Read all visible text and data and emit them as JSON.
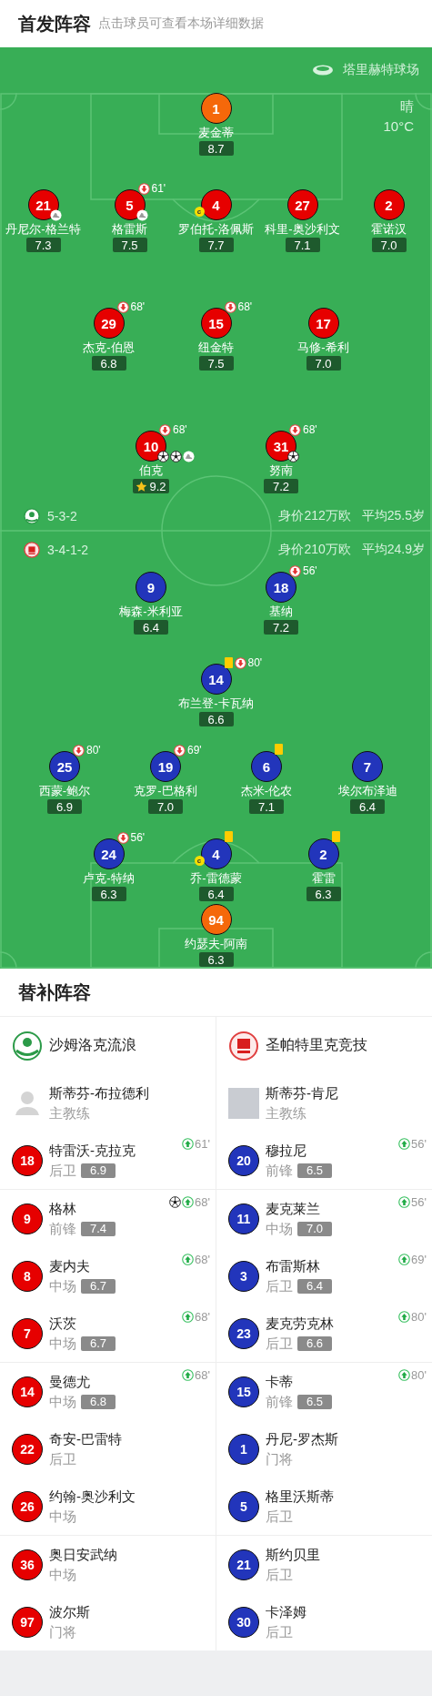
{
  "header": {
    "title": "首发阵容",
    "subtitle": "点击球员可查看本场详细数据"
  },
  "pitch": {
    "venue": "塔里赫特球场",
    "weather": {
      "condition": "晴",
      "temperature": "10°C"
    },
    "home": {
      "formation": "5-3-2",
      "market_value": "身价212万欧",
      "average_age": "平均25.5岁",
      "rows": [
        {
          "players": [
            {
              "number": "1",
              "name": "麦金蒂",
              "rating": "8.7",
              "color": "#f5680a",
              "yellow_card": false,
              "best": false
            }
          ]
        },
        {
          "players": [
            {
              "number": "21",
              "name": "丹尼尔-格兰特",
              "rating": "7.3",
              "color": "#e60000",
              "yellow_card": false,
              "best": false,
              "events": [
                {
                  "kind": "assist"
                }
              ]
            },
            {
              "number": "5",
              "name": "格雷斯",
              "rating": "7.5",
              "color": "#e60000",
              "yellow_card": false,
              "best": false,
              "sub_off": "61'",
              "events": [
                {
                  "kind": "assist"
                }
              ]
            },
            {
              "number": "4",
              "name": "罗伯托-洛佩斯",
              "rating": "7.7",
              "color": "#e60000",
              "captain_badge": "c",
              "yellow_card": false,
              "best": false
            },
            {
              "number": "27",
              "name": "科里-奥沙利文",
              "rating": "7.1",
              "color": "#e60000",
              "yellow_card": false,
              "best": false
            },
            {
              "number": "2",
              "name": "霍诺汉",
              "rating": "7.0",
              "color": "#e60000",
              "yellow_card": false,
              "best": false
            }
          ]
        },
        {
          "players": [
            {
              "number": "29",
              "name": "杰克-伯恩",
              "rating": "6.8",
              "color": "#e60000",
              "yellow_card": false,
              "best": false,
              "sub_off": "68'"
            },
            {
              "number": "15",
              "name": "纽金特",
              "rating": "7.5",
              "color": "#e60000",
              "yellow_card": false,
              "best": false,
              "sub_off": "68'"
            },
            {
              "number": "17",
              "name": "马修-希利",
              "rating": "7.0",
              "color": "#e60000",
              "yellow_card": false,
              "best": false
            }
          ]
        },
        {
          "players": [
            {
              "number": "10",
              "name": "伯克",
              "rating": "9.2",
              "color": "#e60000",
              "yellow_card": false,
              "best": true,
              "sub_off": "68'",
              "events": [
                {
                  "kind": "goal"
                },
                {
                  "kind": "goal"
                },
                {
                  "kind": "assist"
                }
              ]
            },
            {
              "number": "31",
              "name": "努南",
              "rating": "7.2",
              "color": "#e60000",
              "yellow_card": false,
              "best": false,
              "sub_off": "68'",
              "events": [
                {
                  "kind": "goal"
                }
              ]
            }
          ]
        }
      ]
    },
    "away": {
      "formation": "3-4-1-2",
      "market_value": "身价210万欧",
      "average_age": "平均24.9岁",
      "rows": [
        {
          "players": [
            {
              "number": "9",
              "name": "梅森-米利亚",
              "rating": "6.4",
              "color": "#2235bb",
              "yellow_card": false,
              "best": false
            },
            {
              "number": "18",
              "name": "基纳",
              "rating": "7.2",
              "color": "#2235bb",
              "yellow_card": false,
              "best": false,
              "sub_off": "56'"
            }
          ]
        },
        {
          "players": [
            {
              "number": "14",
              "name": "布兰登-卡瓦纳",
              "rating": "6.6",
              "color": "#2235bb",
              "yellow_card": true,
              "best": false,
              "sub_off": "80'"
            }
          ]
        },
        {
          "players": [
            {
              "number": "25",
              "name": "西蒙-鲍尔",
              "rating": "6.9",
              "color": "#2235bb",
              "yellow_card": false,
              "best": false,
              "sub_off": "80'"
            },
            {
              "number": "19",
              "name": "克罗-巴格利",
              "rating": "7.0",
              "color": "#2235bb",
              "yellow_card": false,
              "best": false,
              "sub_off": "69'"
            },
            {
              "number": "6",
              "name": "杰米-伦农",
              "rating": "7.1",
              "color": "#2235bb",
              "yellow_card": true,
              "best": false
            },
            {
              "number": "7",
              "name": "埃尔布泽迪",
              "rating": "6.4",
              "color": "#2235bb",
              "yellow_card": false,
              "best": false
            }
          ]
        },
        {
          "players": [
            {
              "number": "24",
              "name": "卢克-特纳",
              "rating": "6.3",
              "color": "#2235bb",
              "yellow_card": false,
              "best": false,
              "sub_off": "56'"
            },
            {
              "number": "4",
              "name": "乔-雷德蒙",
              "rating": "6.4",
              "color": "#2235bb",
              "captain_badge": "c",
              "yellow_card": true,
              "best": false
            },
            {
              "number": "2",
              "name": "霍雷",
              "rating": "6.3",
              "color": "#2235bb",
              "yellow_card": true,
              "best": false
            }
          ]
        },
        {
          "players": [
            {
              "number": "94",
              "name": "约瑟夫-阿南",
              "rating": "6.3",
              "color": "#f5680a",
              "yellow_card": false,
              "best": false
            }
          ]
        }
      ]
    }
  },
  "substitutes": {
    "title": "替补阵容",
    "teams": [
      {
        "name": "沙姆洛克流浪",
        "color": "#e60000"
      },
      {
        "name": "圣帕特里克竞技",
        "color": "#2235bb"
      }
    ],
    "coaches": [
      {
        "name": "斯蒂芬-布拉德利",
        "role": "主教练",
        "kind": "silhouette"
      },
      {
        "name": "斯蒂芬-肯尼",
        "role": "主教练",
        "kind": "photo"
      }
    ],
    "groups": [
      [
        {
          "home": {
            "number": "18",
            "name": "特雷沃-克拉克",
            "position": "后卫",
            "rating": "6.9",
            "sub_on": "61'"
          },
          "away": {
            "number": "20",
            "name": "穆拉尼",
            "position": "前锋",
            "rating": "6.5",
            "sub_on": "56'"
          }
        }
      ],
      [
        {
          "home": {
            "number": "9",
            "name": "格林",
            "position": "前锋",
            "rating": "7.4",
            "sub_on": "68'",
            "events": [
              {
                "kind": "goal"
              }
            ]
          },
          "away": {
            "number": "11",
            "name": "麦克莱兰",
            "position": "中场",
            "rating": "7.0",
            "sub_on": "56'"
          }
        },
        {
          "home": {
            "number": "8",
            "name": "麦内夫",
            "position": "中场",
            "rating": "6.7",
            "sub_on": "68'"
          },
          "away": {
            "number": "3",
            "name": "布雷斯林",
            "position": "后卫",
            "rating": "6.4",
            "sub_on": "69'"
          }
        },
        {
          "home": {
            "number": "7",
            "name": "沃茨",
            "position": "中场",
            "rating": "6.7",
            "sub_on": "68'"
          },
          "away": {
            "number": "23",
            "name": "麦克劳克林",
            "position": "后卫",
            "rating": "6.6",
            "sub_on": "80'"
          }
        }
      ],
      [
        {
          "home": {
            "number": "14",
            "name": "曼德尤",
            "position": "中场",
            "rating": "6.8",
            "sub_on": "68'"
          },
          "away": {
            "number": "15",
            "name": "卡蒂",
            "position": "前锋",
            "rating": "6.5",
            "sub_on": "80'"
          }
        },
        {
          "home": {
            "number": "22",
            "name": "奇安-巴雷特",
            "position": "后卫"
          },
          "away": {
            "number": "1",
            "name": "丹尼-罗杰斯",
            "position": "门将"
          }
        },
        {
          "home": {
            "number": "26",
            "name": "约翰-奥沙利文",
            "position": "中场"
          },
          "away": {
            "number": "5",
            "name": "格里沃斯蒂",
            "position": "后卫"
          }
        }
      ],
      [
        {
          "home": {
            "number": "36",
            "name": "奥日安武纳",
            "position": "中场"
          },
          "away": {
            "number": "21",
            "name": "斯约贝里",
            "position": "后卫"
          }
        },
        {
          "home": {
            "number": "97",
            "name": "波尔斯",
            "position": "门将"
          },
          "away": {
            "number": "30",
            "name": "卡泽姆",
            "position": "后卫"
          }
        }
      ]
    ]
  }
}
